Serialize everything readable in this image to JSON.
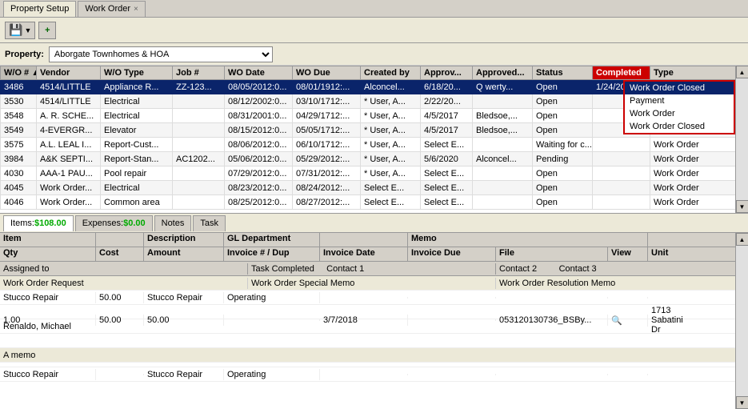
{
  "titleBar": {
    "tab1": "Property Setup",
    "tab2": "Work Order",
    "closeIcon": "×"
  },
  "toolbar": {
    "saveDropdownIcon": "▼",
    "addIcon": "+",
    "saveLabel": "Save"
  },
  "property": {
    "label": "Property:",
    "value": "Aborgate Townhomes & HOA"
  },
  "table": {
    "columns": [
      "W/O #",
      "Vendor",
      "W/O Type",
      "Job #",
      "WO Date",
      "WO Due",
      "Created by",
      "Approv...",
      "Approved...",
      "Status",
      "Completed",
      "Type"
    ],
    "sortedCol": 0,
    "rows": [
      {
        "wo": "3486",
        "vendor": "4514/LITTLE",
        "type": "Appliance R...",
        "job": "ZZ-123...",
        "date": "08/05/2012:0...",
        "due": "08/01/1912:...",
        "created": "Alconcel...",
        "approv1": "6/18/20...",
        "approv2": "Q werty...",
        "status": "Open",
        "completed": "1/24/2022",
        "woType": "Work Order Closed",
        "selected": true
      },
      {
        "wo": "3530",
        "vendor": "4514/LITTLE",
        "type": "Electrical",
        "job": "",
        "date": "08/12/2002:0...",
        "due": "03/10/1712:...",
        "created": "* User, A...",
        "approv1": "2/22/20...",
        "approv2": "",
        "status": "Open",
        "completed": "",
        "woType": "Work Order",
        "selected": false
      },
      {
        "wo": "3548",
        "vendor": "A. R. SCHE...",
        "type": "Electrical",
        "job": "",
        "date": "08/31/2001:0...",
        "due": "04/29/1712:...",
        "created": "* User, A...",
        "approv1": "4/5/2017",
        "approv2": "Bledsoe,...",
        "status": "Open",
        "completed": "",
        "woType": "Work Order",
        "selected": false
      },
      {
        "wo": "3549",
        "vendor": "4-EVERGR...",
        "type": "Elevator",
        "job": "",
        "date": "08/15/2012:0...",
        "due": "05/05/1712:...",
        "created": "* User, A...",
        "approv1": "4/5/2017",
        "approv2": "Bledsoe,...",
        "status": "Open",
        "completed": "",
        "woType": "Work Order",
        "selected": false
      },
      {
        "wo": "3575",
        "vendor": "A.L. LEAL I...",
        "type": "Report-Cust...",
        "job": "",
        "date": "08/06/2012:0...",
        "due": "06/10/1712:...",
        "created": "* User, A...",
        "approv1": "Select E...",
        "approv2": "",
        "status": "Waiting for c...",
        "completed": "",
        "woType": "Work Order",
        "selected": false
      },
      {
        "wo": "3984",
        "vendor": "A&K SEPTI...",
        "type": "Report-Stan...",
        "job": "AC1202...",
        "date": "05/06/2012:0...",
        "due": "05/29/2012:...",
        "created": "* User, A...",
        "approv1": "5/6/2020",
        "approv2": "Alconcel...",
        "status": "Pending",
        "completed": "",
        "woType": "Work Order",
        "selected": false
      },
      {
        "wo": "4030",
        "vendor": "AAA-1 PAU...",
        "type": "Pool repair",
        "job": "",
        "date": "07/29/2012:0...",
        "due": "07/31/2012:...",
        "created": "* User, A...",
        "approv1": "Select E...",
        "approv2": "",
        "status": "Open",
        "completed": "",
        "woType": "Work Order",
        "selected": false
      },
      {
        "wo": "4045",
        "vendor": "Work Order...",
        "type": "Electrical",
        "job": "",
        "date": "08/23/2012:0...",
        "due": "08/24/2012:...",
        "created": "Select E...",
        "approv1": "Select E...",
        "approv2": "",
        "status": "Open",
        "completed": "",
        "woType": "Work Order",
        "selected": false
      },
      {
        "wo": "4046",
        "vendor": "Work Order...",
        "type": "Common area",
        "job": "",
        "date": "08/25/2012:0...",
        "due": "08/27/2012:...",
        "created": "Select E...",
        "approv1": "Select E...",
        "approv2": "",
        "status": "Open",
        "completed": "",
        "woType": "Work Order",
        "selected": false
      }
    ]
  },
  "dropdown": {
    "items": [
      "Work Order Closed",
      "Payment",
      "Work Order",
      "Work Order Closed"
    ]
  },
  "bottomTabs": [
    {
      "label": "Items:",
      "amount": "$108.00",
      "active": true
    },
    {
      "label": "Expenses:",
      "amount": "$0.00",
      "active": false
    },
    {
      "label": "Notes",
      "active": false
    },
    {
      "label": "Task",
      "active": false
    }
  ],
  "detailHeaders": {
    "row1": [
      "Item",
      "",
      "Description",
      "GL Department",
      "",
      "Memo",
      "",
      "",
      ""
    ],
    "row2": [
      "Qty",
      "Cost",
      "Amount",
      "Invoice # / Dup",
      "Invoice Date",
      "Invoice Due",
      "File",
      "View",
      "Unit"
    ]
  },
  "fieldRows": {
    "assignedTo": "Assigned to",
    "taskCompleted": "Task Completed",
    "contact1": "Contact 1",
    "contact2": "Contact 2",
    "contact3": "Contact 3",
    "workOrderRequest": "Work Order Request",
    "workOrderSpecialMemo": "Work Order Special Memo",
    "workOrderResolutionMemo": "Work Order Resolution Memo"
  },
  "detailData": [
    {
      "item": "Stucco Repair",
      "cost": "50.00",
      "description": "Stucco Repair",
      "amount": "50.00",
      "glDept": "Operating",
      "invoiceDate": "",
      "invoiceDue": "",
      "file": "",
      "fileText": "3/7/2018",
      "fileNum": "053120130736_BSBy...",
      "view": "🔍",
      "unit": "1713 Sabatini Dr"
    }
  ],
  "assignedTo": "Renaldo, Michael",
  "memo": "A memo",
  "detailData2": [
    {
      "item": "Stucco Repair",
      "description": "Stucco Repair",
      "glDept": "Operating"
    }
  ]
}
